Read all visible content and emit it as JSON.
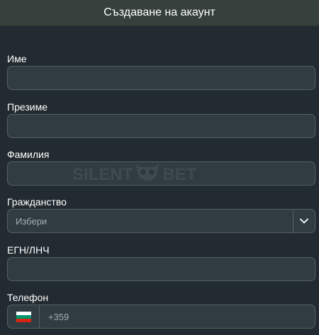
{
  "header": {
    "title": "Създаване на акаунт"
  },
  "form": {
    "first_name": {
      "label": "Име",
      "value": ""
    },
    "middle_name": {
      "label": "Презиме",
      "value": ""
    },
    "last_name": {
      "label": "Фамилия",
      "value": ""
    },
    "citizenship": {
      "label": "Гражданство",
      "selected": "Избери"
    },
    "egn": {
      "label": "ЕГН/ЛНЧ",
      "value": ""
    },
    "phone": {
      "label": "Телефон",
      "prefix": "+359",
      "flag": "bulgaria-flag"
    }
  },
  "watermark": {
    "text_left": "SILENT",
    "text_right": "BET",
    "icon": "owl-icon"
  },
  "colors": {
    "background": "#222b31",
    "header": "#36413d",
    "field": "#303b42",
    "border": "#55625f",
    "flag_white": "#ffffff",
    "flag_green": "#00966e",
    "flag_red": "#d62612"
  }
}
